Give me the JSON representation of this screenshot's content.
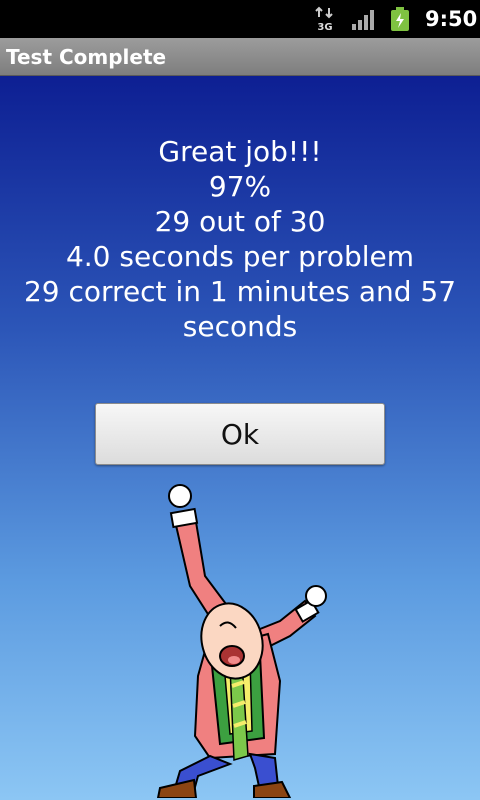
{
  "status_bar": {
    "network": "3G",
    "time": "9:50",
    "icons": [
      "data-arrows-icon",
      "signal-icon",
      "battery-charging-icon"
    ]
  },
  "title_bar": {
    "title": "Test Complete"
  },
  "results": {
    "lines": [
      "Great job!!!",
      "97%",
      "29 out of 30",
      "4.0 seconds per problem",
      "29 correct in 1 minutes and 57",
      "seconds"
    ]
  },
  "ok_button": {
    "label": "Ok"
  },
  "colors": {
    "gradient_top": "#0d1f93",
    "gradient_bottom": "#8cc6f4",
    "title_bar": "#8a8a8a",
    "text": "#ffffff"
  }
}
